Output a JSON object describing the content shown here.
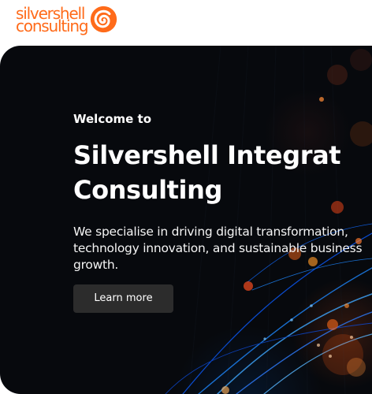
{
  "header": {
    "logo": {
      "line1": "silvershell",
      "line2": "consulting",
      "icon": "spiral-logo-icon",
      "color": "#ff6b1a"
    }
  },
  "hero": {
    "kicker": "Welcome to",
    "title_line1": "Silvershell Integrat",
    "title_line2": "Consulting",
    "description": "We specialise in driving digital transformation, technology innovation, and sustainable business growth.",
    "button_label": "Learn more",
    "background_color": "#07090d",
    "accent_orange": "#ff6b1a",
    "accent_blue": "#1e88ff"
  }
}
